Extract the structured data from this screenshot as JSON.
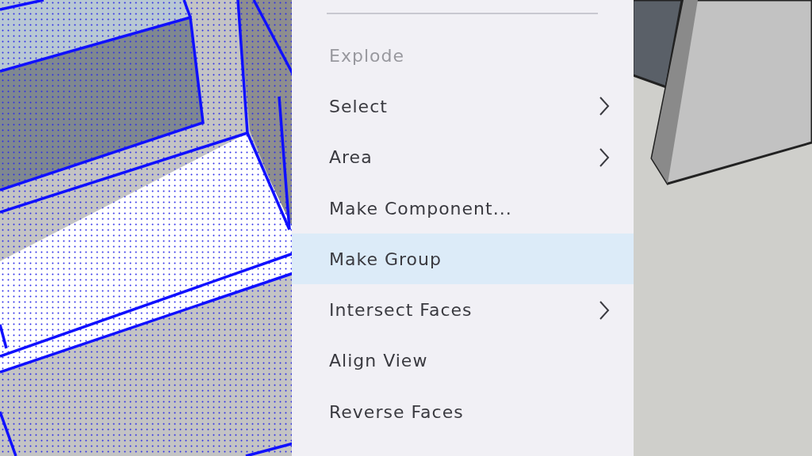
{
  "context_menu": {
    "items": [
      {
        "label": "Explode",
        "disabled": true,
        "selected": false,
        "submenu": false
      },
      {
        "label": "Select",
        "disabled": false,
        "selected": false,
        "submenu": true
      },
      {
        "label": "Area",
        "disabled": false,
        "selected": false,
        "submenu": true
      },
      {
        "label": "Make Component...",
        "disabled": false,
        "selected": false,
        "submenu": false
      },
      {
        "label": "Make Group",
        "disabled": false,
        "selected": true,
        "submenu": false
      },
      {
        "label": "Intersect Faces",
        "disabled": false,
        "selected": false,
        "submenu": true
      },
      {
        "label": "Align View",
        "disabled": false,
        "selected": false,
        "submenu": false
      },
      {
        "label": "Reverse Faces",
        "disabled": false,
        "selected": false,
        "submenu": false
      }
    ]
  }
}
